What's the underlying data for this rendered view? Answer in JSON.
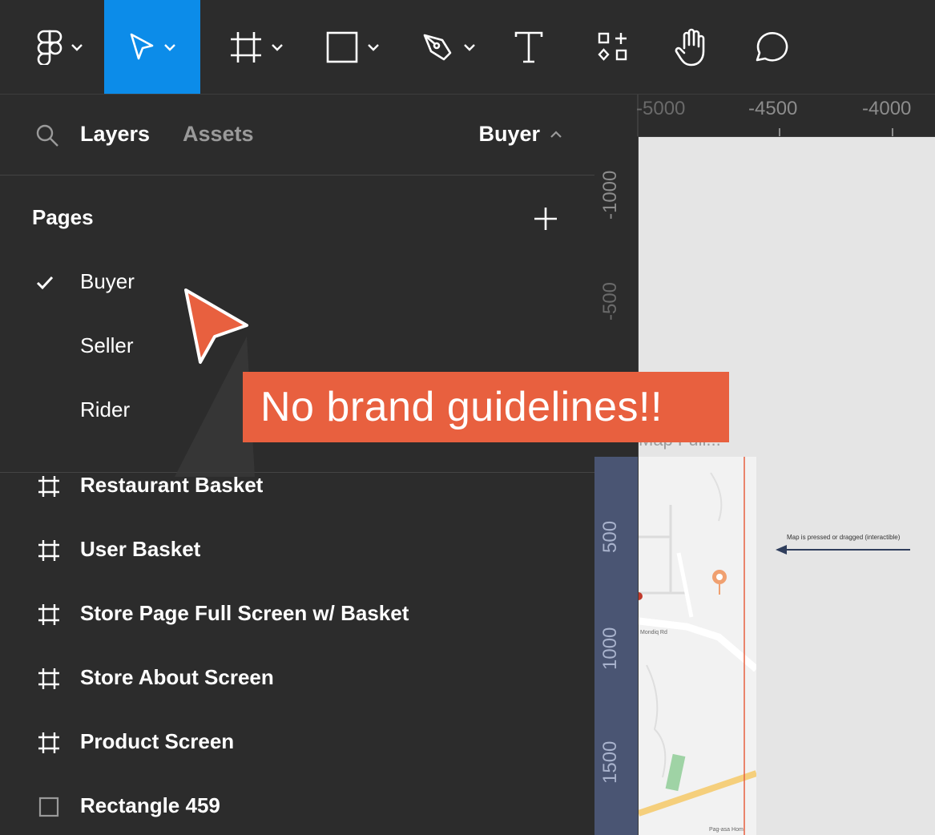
{
  "toolbar": {
    "tools": [
      {
        "name": "figma-menu"
      },
      {
        "name": "move-tool",
        "active": true
      },
      {
        "name": "frame-tool"
      },
      {
        "name": "shape-tool"
      },
      {
        "name": "pen-tool"
      },
      {
        "name": "text-tool"
      },
      {
        "name": "resources-tool"
      },
      {
        "name": "hand-tool"
      },
      {
        "name": "comment-tool"
      }
    ],
    "accent": "#0c8ce9"
  },
  "left_panel": {
    "tabs": [
      {
        "label": "Layers",
        "active": true
      },
      {
        "label": "Assets",
        "active": false
      }
    ],
    "current_page": "Buyer",
    "pages_header": "Pages",
    "pages": [
      {
        "label": "Buyer",
        "selected": true
      },
      {
        "label": "Seller",
        "selected": false
      },
      {
        "label": "Rider",
        "selected": false
      }
    ],
    "layers": [
      {
        "label": "Restaurant Basket",
        "icon": "frame-icon"
      },
      {
        "label": "User Basket",
        "icon": "frame-icon"
      },
      {
        "label": "Store Page Full Screen w/ Basket",
        "icon": "frame-icon"
      },
      {
        "label": "Store About Screen",
        "icon": "frame-icon"
      },
      {
        "label": "Product Screen",
        "icon": "frame-icon"
      },
      {
        "label": "Rectangle 459",
        "icon": "rectangle-icon"
      }
    ]
  },
  "canvas": {
    "ruler_top": [
      "-5000",
      "-4500",
      "-4000"
    ],
    "ruler_left": [
      "-1000",
      "-500",
      "500",
      "1000",
      "1500"
    ],
    "frame_title": "Map Full...",
    "annotation": "Map is pressed or dragged (interactible)",
    "map_labels": [
      "Mondiq Rd",
      "Pag-asa Hom"
    ],
    "background": "#e5e5e5"
  },
  "callout": {
    "text": "No brand guidelines!!",
    "color": "#e8603f"
  }
}
